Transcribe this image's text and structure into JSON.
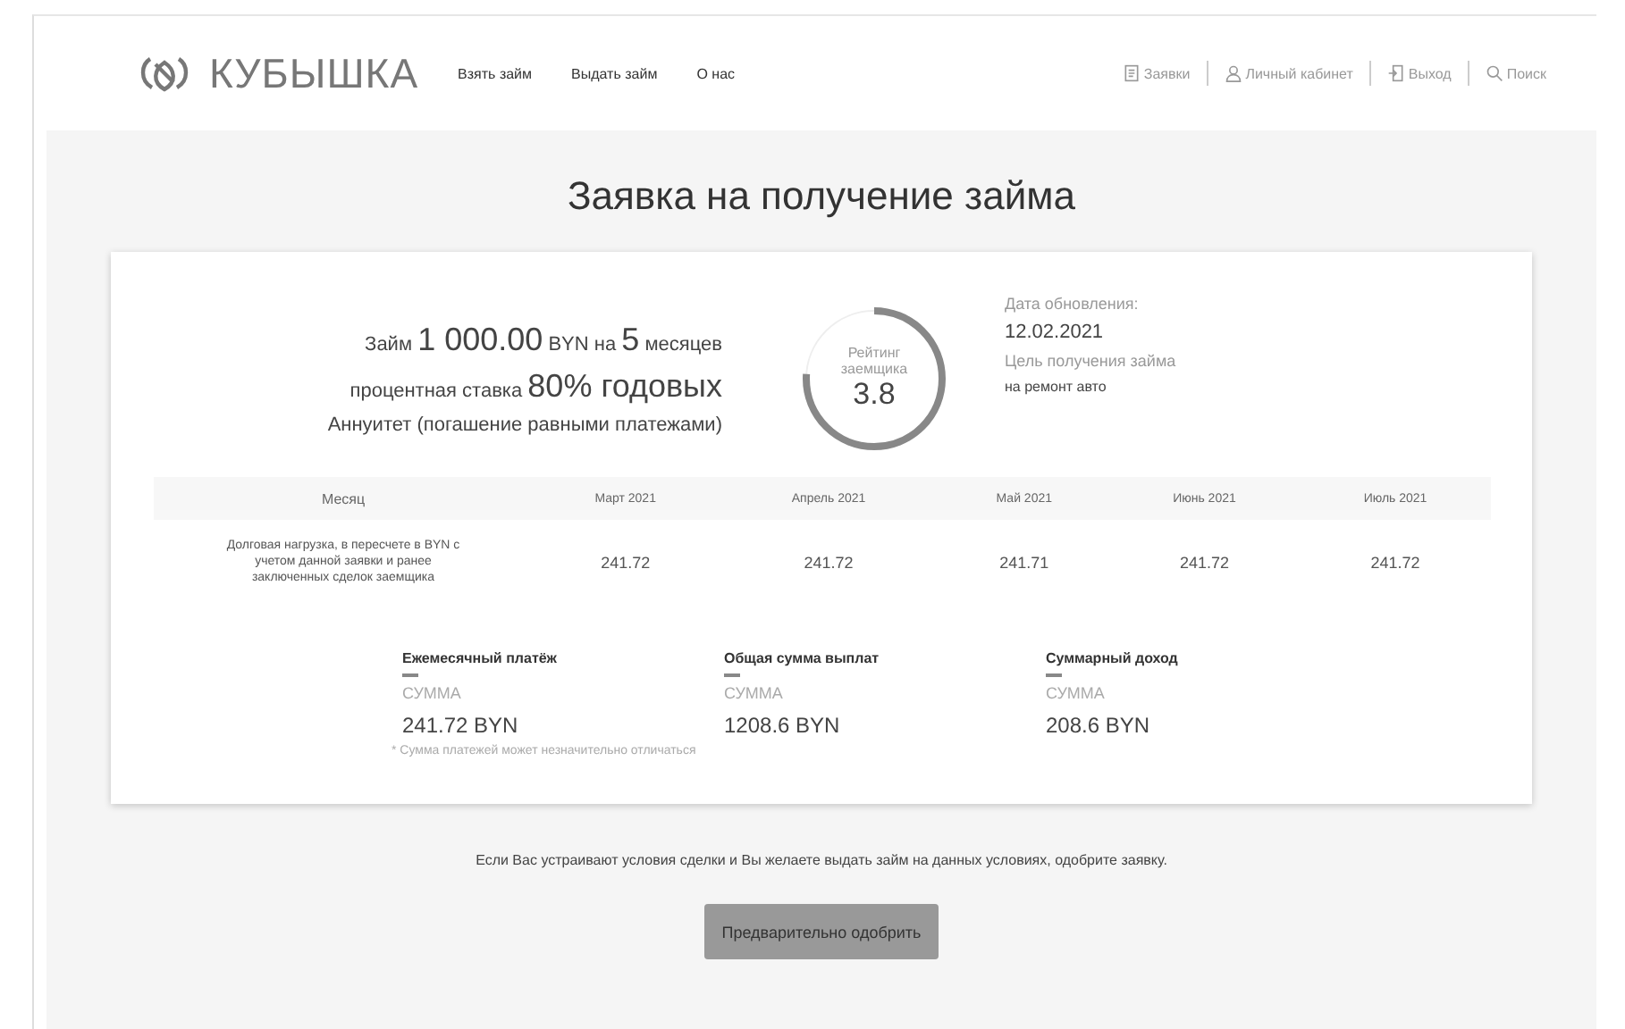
{
  "header": {
    "logo": "КУБЫШКА",
    "nav": [
      {
        "label": "Взять займ"
      },
      {
        "label": "Выдать займ"
      },
      {
        "label": "О нас"
      }
    ],
    "links": [
      {
        "kind": "doc",
        "label": "Заявки"
      },
      {
        "kind": "user",
        "label": "Личный кабинет"
      },
      {
        "kind": "exit",
        "label": "Выход"
      },
      {
        "kind": "search",
        "label": "Поиск"
      }
    ]
  },
  "title": "Заявка на получение займа",
  "loan": {
    "lines": [
      [
        {
          "text": "Займ ",
          "big": false
        },
        {
          "text": "1 000.00",
          "big": true
        },
        {
          "text": " BYN на ",
          "big": false
        },
        {
          "text": "5",
          "big": true
        },
        {
          "text": " месяцев",
          "big": false
        }
      ],
      [
        {
          "text": "процентная ставка ",
          "big": false
        },
        {
          "text": "80% годовых",
          "big": true
        }
      ]
    ],
    "type": "Аннуитет (погашение равными платежами)"
  },
  "rating": {
    "label": "Рейтинг заемщика",
    "value": "3.8",
    "level": 0.76
  },
  "info": {
    "date_label": "Дата обновления:",
    "date": "12.02.2021",
    "purpose_label": "Цель получения займа",
    "purpose": "на ремонт авто"
  },
  "table": {
    "columns": [
      "Месяц",
      "Март 2021",
      "Апрель 2021",
      "Май 2021",
      "Июнь 2021",
      "Июль 2021"
    ],
    "rows": [
      {
        "label": "Долговая нагрузка, в пересчете в BYN с учетом данной заявки и ранее заключенных сделок заемщика",
        "values": [
          "241.72",
          "241.72",
          "241.71",
          "241.72",
          "241.72"
        ]
      }
    ]
  },
  "totals": [
    {
      "title": "Ежемесячный платёж",
      "label": "СУММА",
      "value": "241.72 BYN"
    },
    {
      "title": "Общая сумма выплат",
      "label": "СУММА",
      "value": "1208.6 BYN"
    },
    {
      "title": "Суммарный доход",
      "label": "СУММА",
      "value": "208.6 BYN"
    }
  ],
  "note": "* Сумма платежей может незначительно отличаться",
  "prompt": "Если Вас устраивают условия сделки и Вы желаете выдать займ на данных условиях, одобрите заявку.",
  "button": "Предварительно одобрить"
}
